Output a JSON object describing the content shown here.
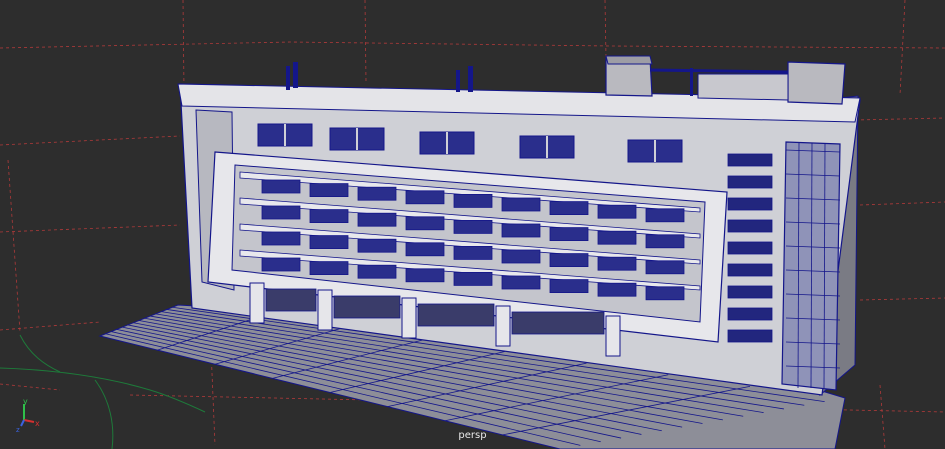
{
  "viewport": {
    "camera_label": "persp",
    "background_color": "#2d2d2d",
    "grid_line_color": "#b03a3a",
    "grid_axis_color": "#1e7a3a"
  },
  "model": {
    "wire_color": "#14168a",
    "face_light_color": "#dcdce0",
    "face_mid_color": "#a9aab0",
    "face_shadow_color": "#8c8c94"
  },
  "axis_gizmo": {
    "x_label": "x",
    "y_label": "y",
    "z_label": "z",
    "x_color": "#d42f2f",
    "y_color": "#2fbf4a",
    "z_color": "#3a62e0"
  }
}
